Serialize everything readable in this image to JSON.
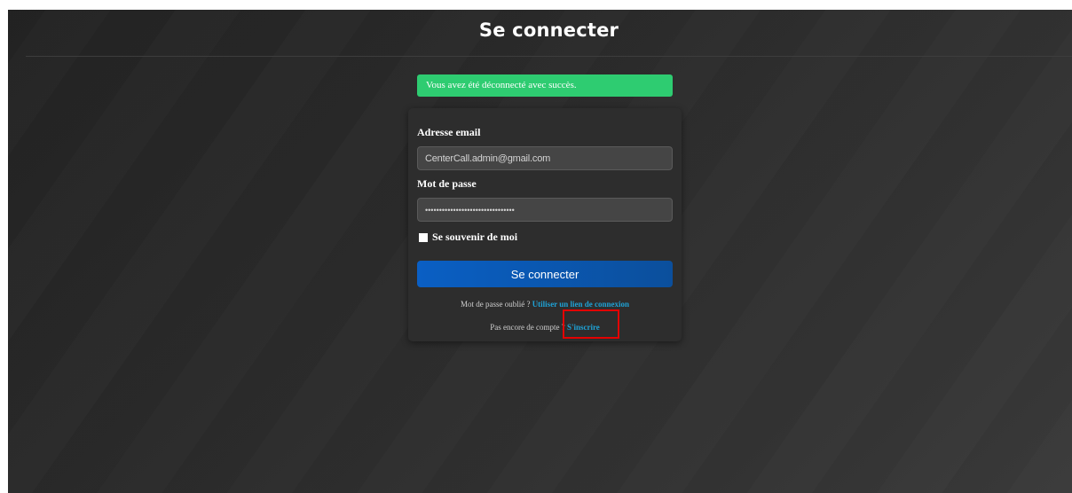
{
  "header": {
    "title": "Se connecter"
  },
  "alert": {
    "message": "Vous avez été déconnecté avec succès."
  },
  "form": {
    "email_label": "Adresse email",
    "email_value": "CenterCall.admin@gmail.com",
    "password_label": "Mot de passe",
    "password_value": "••••••••••••••••••••••••••••••••",
    "remember_label": "Se souvenir de moi",
    "remember_checked": false,
    "submit_label": "Se connecter"
  },
  "links": {
    "forgot_text": "Mot de passe oublié ?",
    "forgot_link": "Utiliser un lien de connexion",
    "signup_text": "Pas encore de compte ?",
    "signup_link": "S'inscrire"
  },
  "colors": {
    "alert_bg": "#2ecc71",
    "primary_button": "#0a5fc4",
    "link": "#1ea2d6",
    "highlight": "#e30000"
  }
}
